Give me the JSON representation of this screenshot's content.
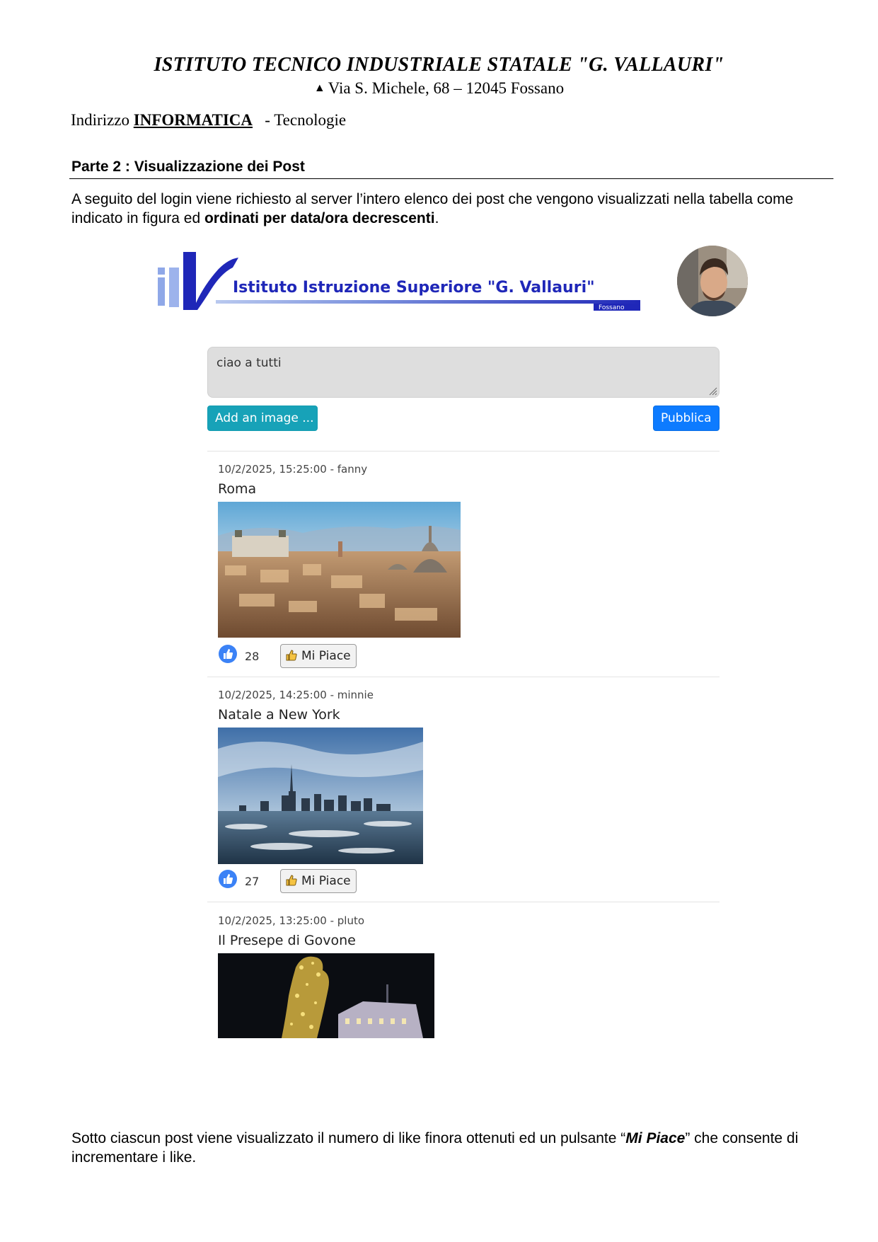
{
  "header": {
    "school_title": "ISTITUTO TECNICO INDUSTRIALE STATALE \"G. VALLAURI\"",
    "address": "Via S. Michele, 68 – 12045 Fossano",
    "course_prefix": "Indirizzo ",
    "course_name": "INFORMATICA",
    "course_suffix": "   - Tecnologie"
  },
  "section": {
    "title": "Parte 2 : Visualizzazione dei Post",
    "intro_text": "A seguito del login viene richiesto al server l’intero elenco dei post che vengono visualizzati nella tabella come indicato in figura ed ",
    "intro_bold": "ordinati per data/ora decrescenti",
    "intro_end": ".",
    "outro_text": "Sotto ciascun post viene visualizzato il numero di like finora ottenuti ed un pulsante “",
    "outro_bold": "Mi Piace",
    "outro_end": "” che consente di incrementare i like."
  },
  "app": {
    "logo_text": "Istituto Istruzione Superiore \"G. Vallauri\"",
    "logo_subtext": "Fossano",
    "logo_letters": "iis",
    "textarea_value": "ciao a tutti",
    "add_image_label": "Add an image ...",
    "publish_label": "Pubblica",
    "like_label": "Mi Piace",
    "posts": [
      {
        "meta": "10/2/2025, 15:25:00 - fanny",
        "title": "Roma",
        "likes": "28",
        "image": "rome-skyline"
      },
      {
        "meta": "10/2/2025, 14:25:00 - minnie",
        "title": "Natale a New York",
        "likes": "27",
        "image": "new-york-skyline"
      },
      {
        "meta": "10/2/2025, 13:25:00 - pluto",
        "title": "Il Presepe di Govone",
        "image": "govone-lights"
      }
    ]
  },
  "colors": {
    "logo_blue": "#1f27b8",
    "info_button": "#17a2b8",
    "primary_button": "#0d7bff",
    "like_icon": "#3b82f6"
  }
}
